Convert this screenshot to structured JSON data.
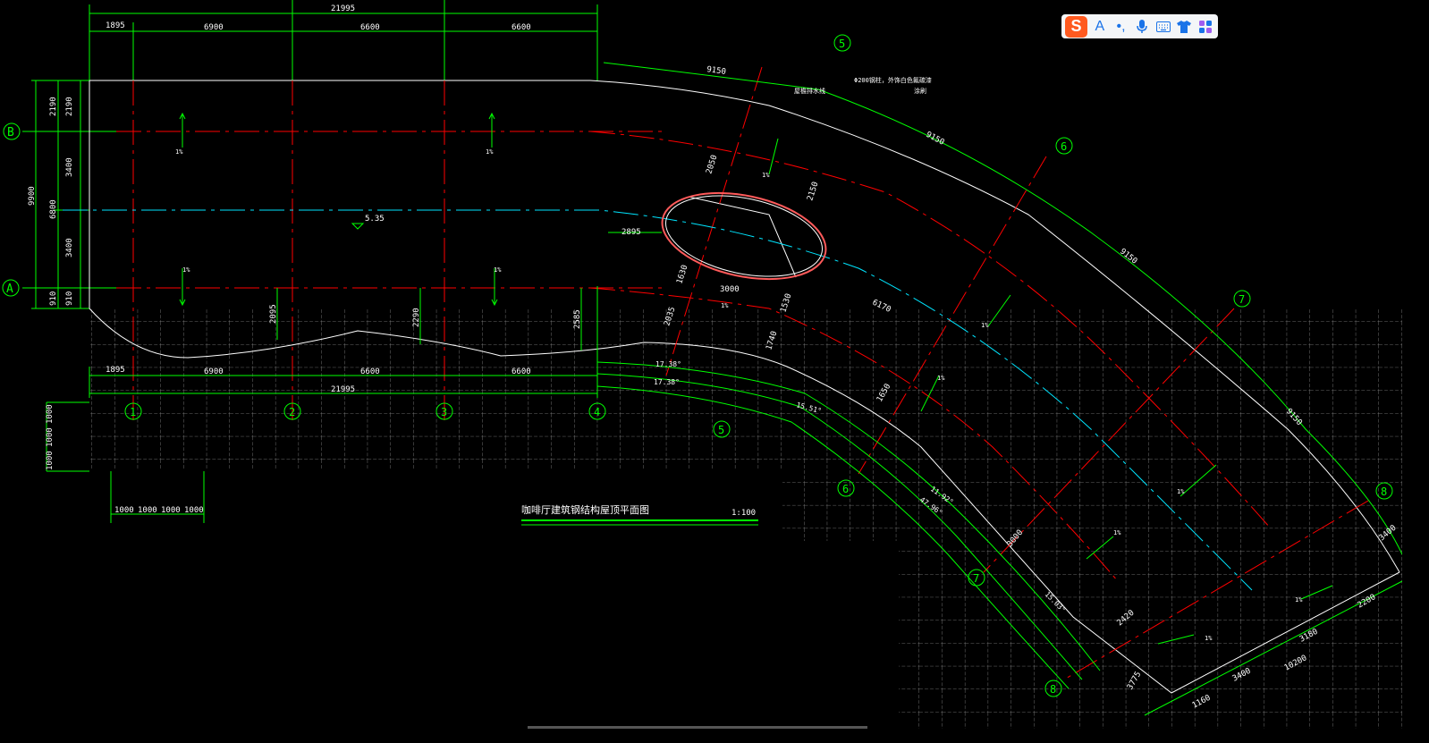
{
  "drawing": {
    "title": "咖啡厅建筑钢结构屋顶平面图",
    "scale": "1:100",
    "top_dims": {
      "total": "21995",
      "seg1": "1895",
      "seg2": "6900",
      "seg3": "6600",
      "seg4": "6600"
    },
    "bottom_dims": {
      "total": "21995",
      "seg1": "1895",
      "seg2": "6900",
      "seg3": "6600",
      "seg4": "6600"
    },
    "left_dims": {
      "total": "9900",
      "a": "2190",
      "b": "2190",
      "c": "6800",
      "d": "3400",
      "e": "3400",
      "f": "910",
      "g": "910"
    },
    "grid_dims": {
      "v1": "1000",
      "v2": "1000",
      "v3": "1000",
      "h1": "1000",
      "h2": "1000",
      "h3": "1000",
      "h4": "1000"
    },
    "axis_labels": {
      "b": "B",
      "a": "A",
      "n1": "1",
      "n2": "2",
      "n3": "3",
      "n4": "4",
      "n5": "5",
      "n5b": "5",
      "n6": "6",
      "n6b": "6",
      "n7": "7",
      "n7b": "7",
      "n8": "8",
      "n8b": "8"
    },
    "curve_dims": {
      "d1": "9150",
      "d2": "9150",
      "d3": "9150",
      "d4": "9150"
    },
    "annotations": {
      "pipe_note": "Φ200钢柱，外饰白色氟碳漆",
      "pipe_note2": "涂刷",
      "drain_note": "屋檐排水线",
      "elevation": "5.35",
      "slope": "1%",
      "dim_2895": "2895",
      "dim_2050": "2050",
      "dim_2150": "2150",
      "dim_1630": "1630",
      "dim_3000": "3000",
      "dim_2035": "2035",
      "dim_1530": "1530",
      "dim_1740": "1740",
      "dim_6170": "6170",
      "dim_2095": "2095",
      "dim_2290": "2290",
      "dim_2585": "2585",
      "dim_1650": "1650",
      "dim_3000b": "3000",
      "dim_2420": "2420",
      "dim_3400": "3400",
      "dim_2200": "2200",
      "dim_3180": "3180",
      "dim_3400b": "3400",
      "dim_10200": "10200",
      "dim_1160": "1160",
      "dim_3775": "3775",
      "angle1": "17.38°",
      "angle2": "17.38°",
      "angle3": "15.51°",
      "angle4": "11.92°",
      "angle5": "47.96°",
      "angle6": "15.03°"
    }
  },
  "ime_toolbar": {
    "logo": "S",
    "lang": "A",
    "punct": "•,",
    "colors": {
      "logo_bg": "#ff5a1f",
      "icon": "#1a73e8"
    }
  },
  "colors": {
    "green": "#00ff00",
    "red": "#ff0000",
    "cyan": "#00e5ff",
    "white": "#ffffff",
    "grid": "#8a8a8a"
  }
}
